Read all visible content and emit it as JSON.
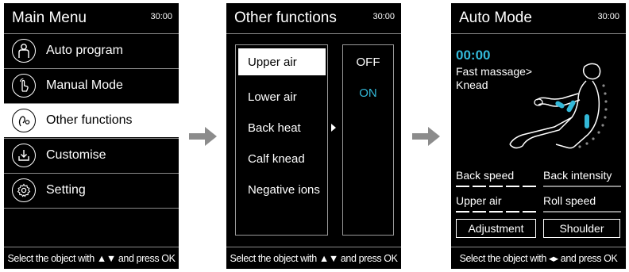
{
  "main_menu": {
    "title": "Main Menu",
    "time": "30:00",
    "items": [
      {
        "label": "Auto program",
        "icon": "person-icon",
        "selected": false
      },
      {
        "label": "Manual Mode",
        "icon": "hand-pointer-icon",
        "selected": false
      },
      {
        "label": "Other functions",
        "icon": "functions-icon",
        "selected": true
      },
      {
        "label": "Customise",
        "icon": "download-icon",
        "selected": false
      },
      {
        "label": "Setting",
        "icon": "gear-icon",
        "selected": false
      }
    ],
    "footer": "Select the object with ▲▼ and press OK"
  },
  "other_functions": {
    "title": "Other functions",
    "time": "30:00",
    "items": [
      {
        "label": "Upper air",
        "selected": true
      },
      {
        "label": "Lower air",
        "selected": false
      },
      {
        "label": "Back heat",
        "selected": false
      },
      {
        "label": "Calf knead",
        "selected": false
      },
      {
        "label": "Negative ions",
        "selected": false
      }
    ],
    "values": [
      {
        "label": "OFF",
        "color": "#ffffff"
      },
      {
        "label": "ON",
        "color": "#33b8d8"
      }
    ],
    "footer": "Select the object with ▲▼ and press OK"
  },
  "auto_mode": {
    "title": "Auto Mode",
    "time": "30:00",
    "timer": "00:00",
    "program_line1": "Fast massage>",
    "program_line2": "Knead",
    "params": {
      "back_speed": "Back speed",
      "back_intensity": "Back intensity",
      "upper_air": "Upper air",
      "roll_speed": "Roll speed"
    },
    "buttons": {
      "adjustment": "Adjustment",
      "shoulder": "Shoulder"
    },
    "footer": "Select the object with ◂▸ and press OK"
  },
  "colors": {
    "accent": "#33b8d8",
    "arrow": "#8c8c8c"
  }
}
